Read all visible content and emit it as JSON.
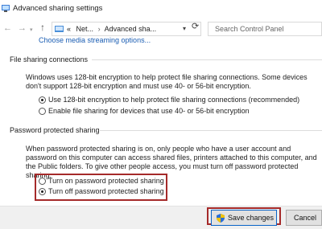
{
  "window": {
    "title": "Advanced sharing settings"
  },
  "nav": {
    "back_icon": "back-arrow-icon",
    "forward_icon": "forward-arrow-icon",
    "up_icon": "up-arrow-icon",
    "overflow": "«",
    "crumbs": [
      "Net...",
      "Advanced sha..."
    ],
    "search_placeholder": "Search Control Panel"
  },
  "top_link": "Choose media streaming options...",
  "file_sharing": {
    "heading": "File sharing connections",
    "description": "Windows uses 128-bit encryption to help protect file sharing connections. Some devices don't support 128-bit encryption and must use 40- or 56-bit encryption.",
    "options": [
      {
        "label": "Use 128-bit encryption to help protect file sharing connections (recommended)",
        "selected": true
      },
      {
        "label": "Enable file sharing for devices that use 40- or 56-bit encryption",
        "selected": false
      }
    ]
  },
  "password_sharing": {
    "heading": "Password protected sharing",
    "description": "When password protected sharing is on, only people who have a user account and password on this computer can access shared files, printers attached to this computer, and the Public folders. To give other people access, you must turn off password protected sharing.",
    "options": [
      {
        "label": "Turn on password protected sharing",
        "selected": false
      },
      {
        "label": "Turn off password protected sharing",
        "selected": true
      }
    ]
  },
  "footer": {
    "save_label": "Save changes",
    "cancel_label": "Cancel"
  },
  "colors": {
    "link": "#1a5db3",
    "highlight": "#a52a2a",
    "accent": "#0a64c8"
  }
}
